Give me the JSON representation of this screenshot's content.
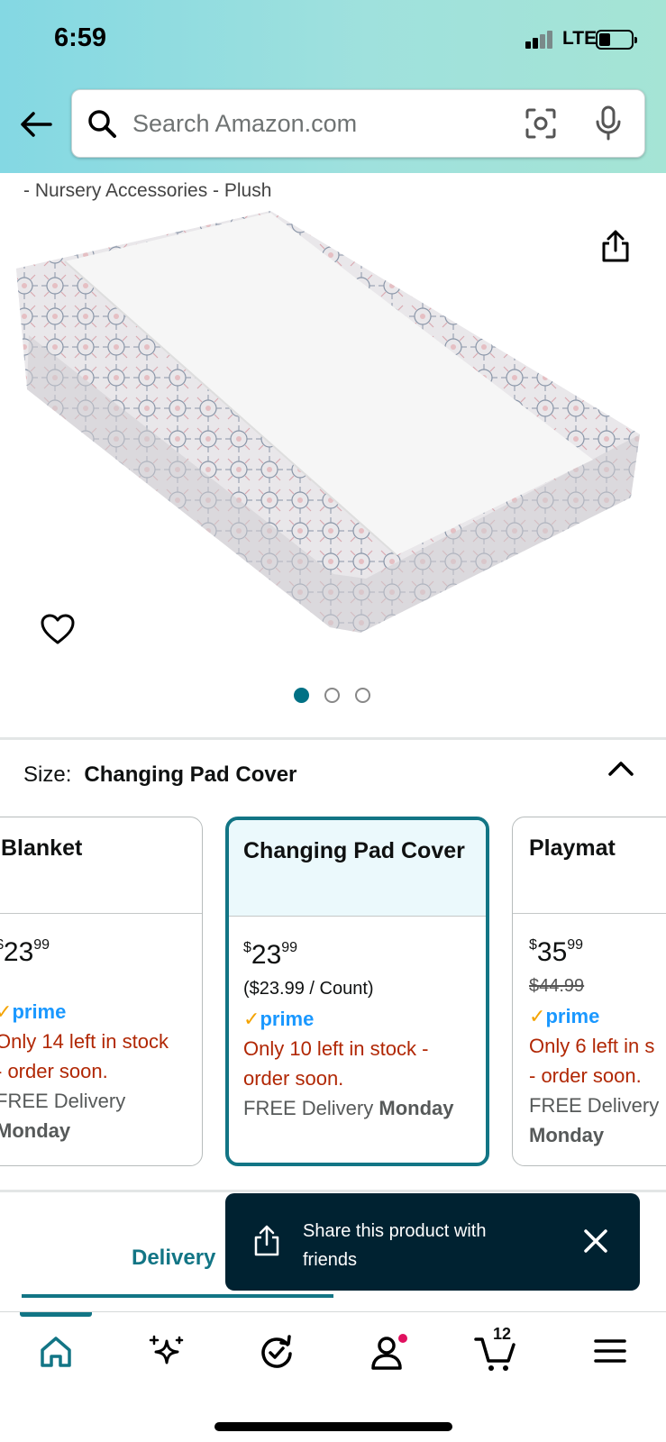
{
  "status_bar": {
    "time": "6:59",
    "network": "LTE"
  },
  "search": {
    "placeholder": "Search Amazon.com"
  },
  "breadcrumb": "- Nursery Accessories - Plush",
  "carousel": {
    "count": 3,
    "active_index": 0
  },
  "size_selector": {
    "label": "Size:",
    "selected": "Changing Pad Cover"
  },
  "variants": [
    {
      "title": "Blanket",
      "price_whole": "23",
      "price_fraction": "99",
      "prime": "prime",
      "stock": "Only 14 left in stock - order soon.",
      "stock_line1": "Only 14 left in stock",
      "stock_line2": "- order soon.",
      "delivery_prefix": "FREE Delivery",
      "delivery_day": "Monday"
    },
    {
      "title": "Changing Pad Cover",
      "price_currency": "$",
      "price_whole": "23",
      "price_fraction": "99",
      "unit_price": "($23.99 / Count)",
      "prime": "prime",
      "stock_line1": "Only 10 left in stock -",
      "stock_line2": "order soon.",
      "delivery_prefix": "FREE Delivery",
      "delivery_day": "Monday"
    },
    {
      "title": "Playmat",
      "price_currency": "$",
      "price_whole": "35",
      "price_fraction": "99",
      "list_price": "$44.99",
      "prime": "prime",
      "stock_line1": "Only 6 left in s",
      "stock_line2": "- order soon.",
      "delivery_prefix": "FREE Delivery",
      "delivery_day": "Monday"
    }
  ],
  "tabs": {
    "delivery": "Delivery"
  },
  "toast": {
    "message": "Share this product with friends"
  },
  "bottom_nav": {
    "items": [
      "home-icon",
      "sparkle-icon",
      "reorder-icon",
      "account-icon",
      "cart-icon",
      "menu-icon"
    ],
    "cart_count": "12"
  },
  "colors": {
    "accent": "#127585",
    "price_red": "#b12704",
    "prime_blue": "#1a98ff",
    "toast_bg": "#002231"
  }
}
